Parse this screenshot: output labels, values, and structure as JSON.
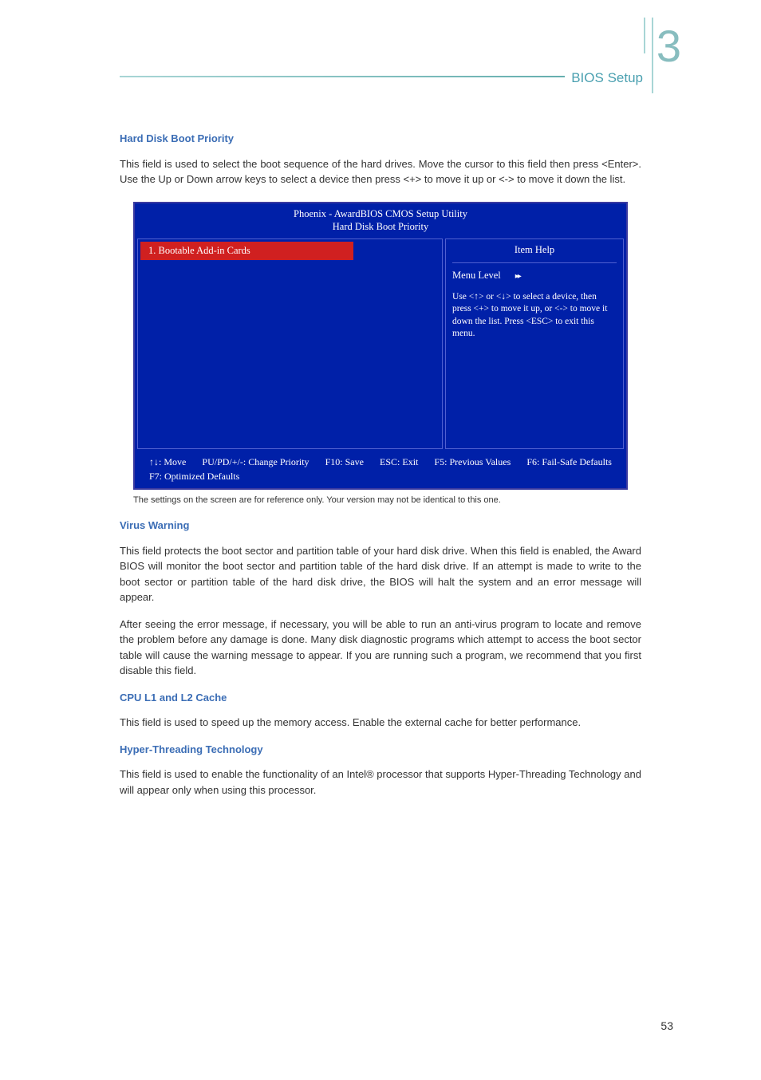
{
  "header": {
    "title": "BIOS Setup",
    "chapter_number": "3"
  },
  "sections": {
    "hard_disk": {
      "heading": "Hard Disk Boot Priority",
      "body": "This field is used to select the boot sequence of the hard drives. Move the cursor to this field then press <Enter>. Use the Up or Down arrow keys to select a device then press <+> to move it up or <-> to move it down the list."
    },
    "virus_warning": {
      "heading": "Virus Warning",
      "body1": "This field protects the boot sector and partition table of your hard disk drive. When this field is enabled, the Award BIOS will monitor the boot sector and partition table of the hard disk drive. If an attempt is made to write to the boot sector or partition table of the hard disk drive, the BIOS will halt the system and an error message will appear.",
      "body2": "After seeing the error message, if necessary, you will be able to run an anti-virus program to locate and remove the problem before any damage is done. Many disk diagnostic programs which attempt to access the boot sector table will cause the warning message to appear. If you are running such a program, we recommend that you first disable this field."
    },
    "cpu_cache": {
      "heading": "CPU L1 and  L2 Cache",
      "body": "This field is used to speed up the memory access. Enable the external cache for better performance."
    },
    "hyper_threading": {
      "heading": "Hyper-Threading Technology",
      "body": "This field is used to enable the functionality of an Intel® processor that supports Hyper-Threading Technology and will appear only when using this processor."
    }
  },
  "bios": {
    "title1": "Phoenix - AwardBIOS CMOS Setup Utility",
    "title2": "Hard Disk Boot Priority",
    "selected_item": "1. Bootable Add-in Cards",
    "help_title": "Item Help",
    "menu_level": "Menu Level",
    "help_text": "Use <↑> or <↓> to select a device, then press <+> to move it up, or <-> to move it down the list. Press <ESC> to exit this menu.",
    "footer": {
      "move": "↑↓: Move",
      "change": "PU/PD/+/-: Change Priority",
      "save": "F10: Save",
      "exit": "ESC: Exit",
      "prev": "F5: Previous Values",
      "failsafe": "F6: Fail-Safe Defaults",
      "optimized": "F7: Optimized Defaults"
    }
  },
  "caption": "The settings on the screen are for reference only. Your version may not be identical to this one.",
  "page_number": "53"
}
